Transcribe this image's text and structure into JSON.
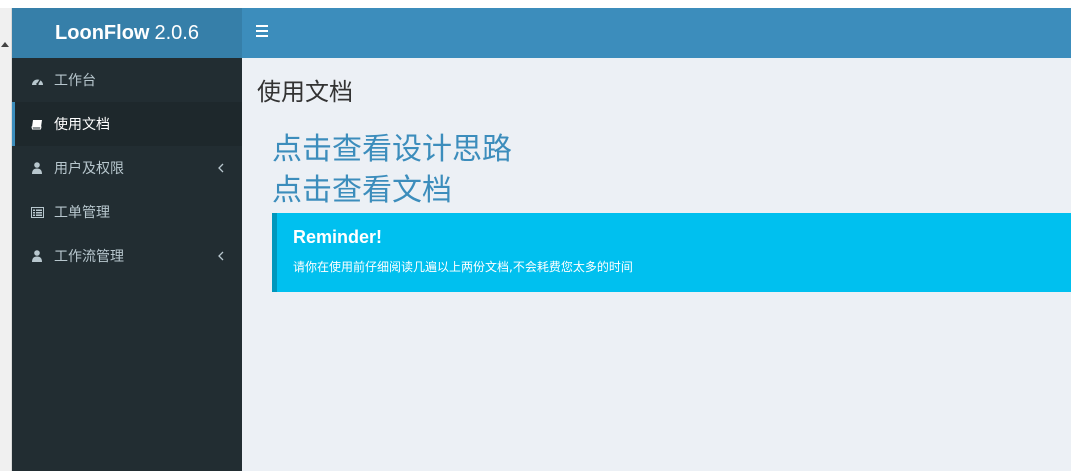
{
  "header": {
    "brand_bold": "LoonFlow",
    "brand_version": "2.0.6"
  },
  "sidebar": {
    "items": [
      {
        "label": "工作台",
        "icon": "dashboard-icon",
        "active": false,
        "has_children": false
      },
      {
        "label": "使用文档",
        "icon": "book-icon",
        "active": true,
        "has_children": false
      },
      {
        "label": "用户及权限",
        "icon": "user-icon",
        "active": false,
        "has_children": true
      },
      {
        "label": "工单管理",
        "icon": "list-icon",
        "active": false,
        "has_children": false
      },
      {
        "label": "工作流管理",
        "icon": "user-icon",
        "active": false,
        "has_children": true
      }
    ]
  },
  "main": {
    "title": "使用文档",
    "links": [
      {
        "label": "点击查看设计思路"
      },
      {
        "label": "点击查看文档"
      }
    ],
    "callout": {
      "title": "Reminder!",
      "text": "请你在使用前仔细阅读几遍以上两份文档,不会耗费您太多的时间"
    }
  },
  "colors": {
    "navbar": "#3c8dbc",
    "logo": "#367fa9",
    "sidebar": "#222d32",
    "sidebar_active": "#1e282c",
    "content_bg": "#ecf0f5",
    "link": "#3c8dbc",
    "callout_bg": "#00c0ef",
    "callout_border": "#0097bc"
  }
}
